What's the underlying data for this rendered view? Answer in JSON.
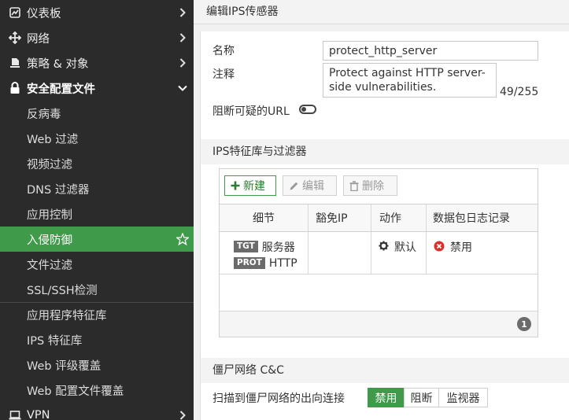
{
  "sidebar": {
    "top_items": [
      {
        "label": "仪表板",
        "icon": "dashboard-icon"
      },
      {
        "label": "网络",
        "icon": "network-move-icon"
      },
      {
        "label": "策略 & 对象",
        "icon": "policy-stamp-icon"
      },
      {
        "label": "安全配置文件",
        "icon": "lock-icon"
      }
    ],
    "sub_items": [
      {
        "label": "反病毒"
      },
      {
        "label": "Web 过滤"
      },
      {
        "label": "视频过滤"
      },
      {
        "label": "DNS 过滤器"
      },
      {
        "label": "应用控制"
      },
      {
        "label": "入侵防御"
      },
      {
        "label": "文件过滤"
      },
      {
        "label": "SSL/SSH检测"
      },
      {
        "label": "应用程序特征库"
      },
      {
        "label": "IPS 特征库"
      },
      {
        "label": "Web 评级覆盖"
      },
      {
        "label": "Web 配置文件覆盖"
      }
    ],
    "bottom_item": {
      "label": "VPN",
      "icon": "laptop-icon"
    }
  },
  "page": {
    "title": "编辑IPS传感器"
  },
  "form": {
    "name_label": "名称",
    "name_value": "protect_http_server",
    "comment_label": "注释",
    "comment_value": "Protect against HTTP server-side vulnerabilities.",
    "comment_counter": "49/255",
    "block_url_label": "阻断可疑的URL"
  },
  "signatures": {
    "section_title": "IPS特征库与过滤器",
    "toolbar": {
      "new_label": "新建",
      "edit_label": "编辑",
      "delete_label": "删除"
    },
    "columns": [
      "细节",
      "豁免IP",
      "动作",
      "数据包日志记录"
    ],
    "row": {
      "tgt_tag": "TGT",
      "tgt_value": "服务器",
      "prot_tag": "PROT",
      "prot_value": "HTTP",
      "action": "默认",
      "packet_logging": "禁用"
    },
    "count": "1"
  },
  "botnet": {
    "section_title": "僵尸网络 C&C",
    "scan_label": "扫描到僵尸网络的出向连接",
    "options": [
      "禁用",
      "阻断",
      "监视器"
    ],
    "selected": "禁用"
  },
  "colors": {
    "accent_green": "#3f9b4a",
    "sidebar_bg": "#2b2b2b",
    "error_red": "#d9302c"
  }
}
